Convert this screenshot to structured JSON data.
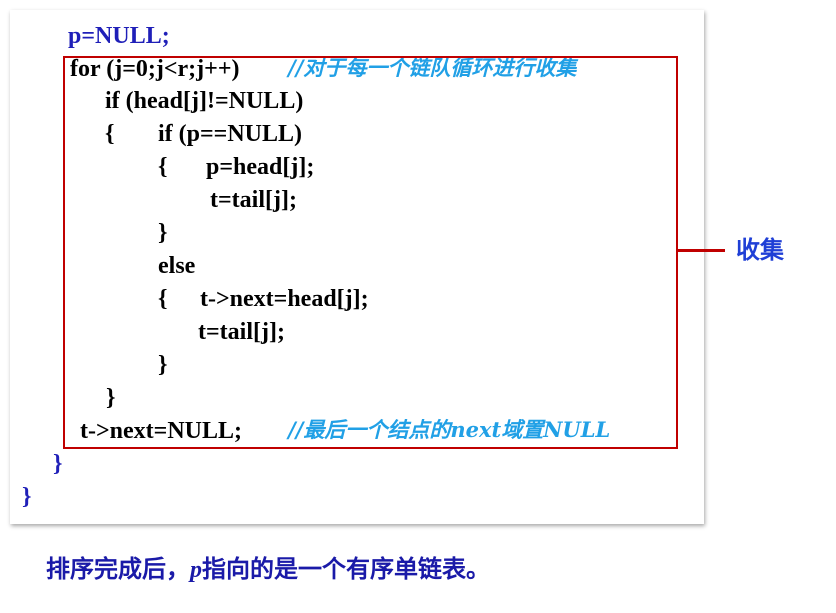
{
  "code": {
    "line_1": "p=NULL;",
    "line_2": "for (j=0;j<r;j++)",
    "comment_2": "//对于每一个链队循环进行收集",
    "line_3": "if (head[j]!=NULL)",
    "line_4_brace": "{",
    "line_4": "if (p==NULL)",
    "line_5_brace": "{",
    "line_5": "p=head[j];",
    "line_6": "t=tail[j];",
    "line_7": "}",
    "line_8": "else",
    "line_9_brace": "{",
    "line_9": "t->next=head[j];",
    "line_10": "t=tail[j];",
    "line_11": "}",
    "line_12": "}",
    "line_13": "t->next=NULL;",
    "comment_13": "//最后一个结点的next域置NULL",
    "line_14": "}",
    "line_15": "}"
  },
  "annotation": {
    "label": "收集",
    "box_color": "#c00000"
  },
  "footer": {
    "prefix": "排序完成后，",
    "var": "p",
    "suffix": "指向的是一个有序单链表。"
  },
  "colors": {
    "code_text": "#000000",
    "keyword_blue": "#1f1fb8",
    "comment": "#21a0e6",
    "label": "#1f3fd6",
    "footer": "#1a1aa8"
  }
}
